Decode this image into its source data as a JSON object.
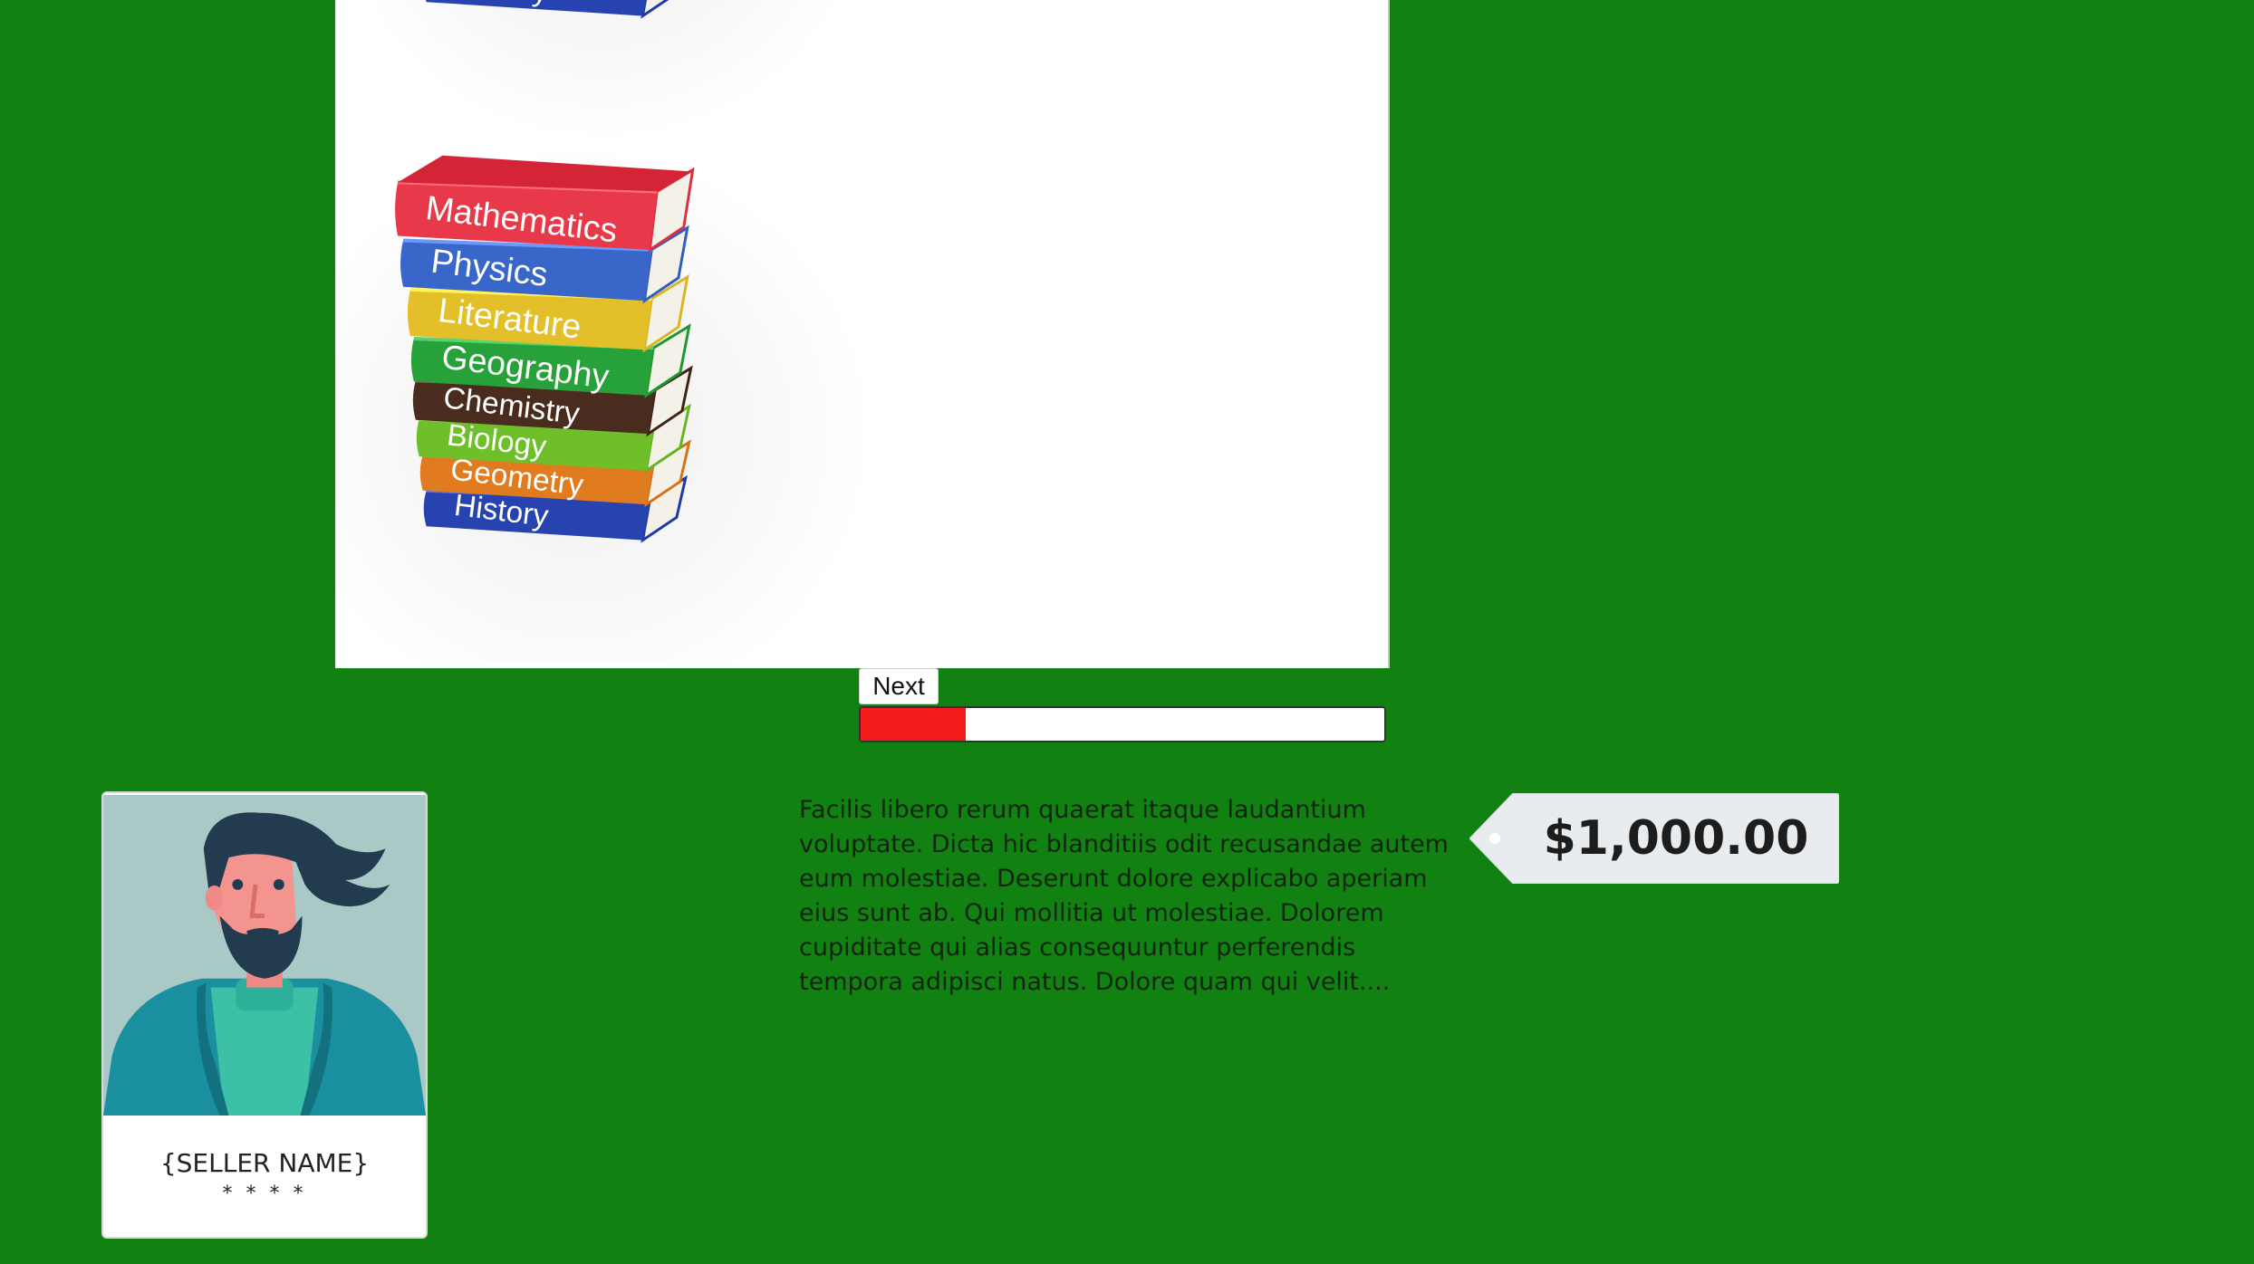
{
  "gallery": {
    "book_spines": [
      "Mathematics",
      "Physics",
      "Literature",
      "Geography",
      "Chemistry",
      "Biology",
      "Geometry",
      "History"
    ],
    "spine_colors": [
      "#e8394a",
      "#3867c9",
      "#e3c02a",
      "#27a23a",
      "#4a2c1e",
      "#6fbf2b",
      "#e07b1f",
      "#2743b0"
    ]
  },
  "carousel": {
    "next_label": "Next",
    "progress_fraction": 0.2,
    "progress_color": "#f41b1b"
  },
  "seller": {
    "name": "{SELLER NAME}",
    "rating": "* * * *"
  },
  "listing": {
    "description": "Facilis libero rerum quaerat itaque laudantium voluptate. Dicta hic blanditiis odit recusandae autem eum molestiae. Deserunt dolore explicabo aperiam eius sunt ab. Qui mollitia ut molestiae. Dolorem cupiditate qui alias consequuntur perferendis tempora adipisci natus. Dolore quam qui velit....",
    "price": "$1,000.00"
  },
  "theme": {
    "background": "#118211"
  }
}
